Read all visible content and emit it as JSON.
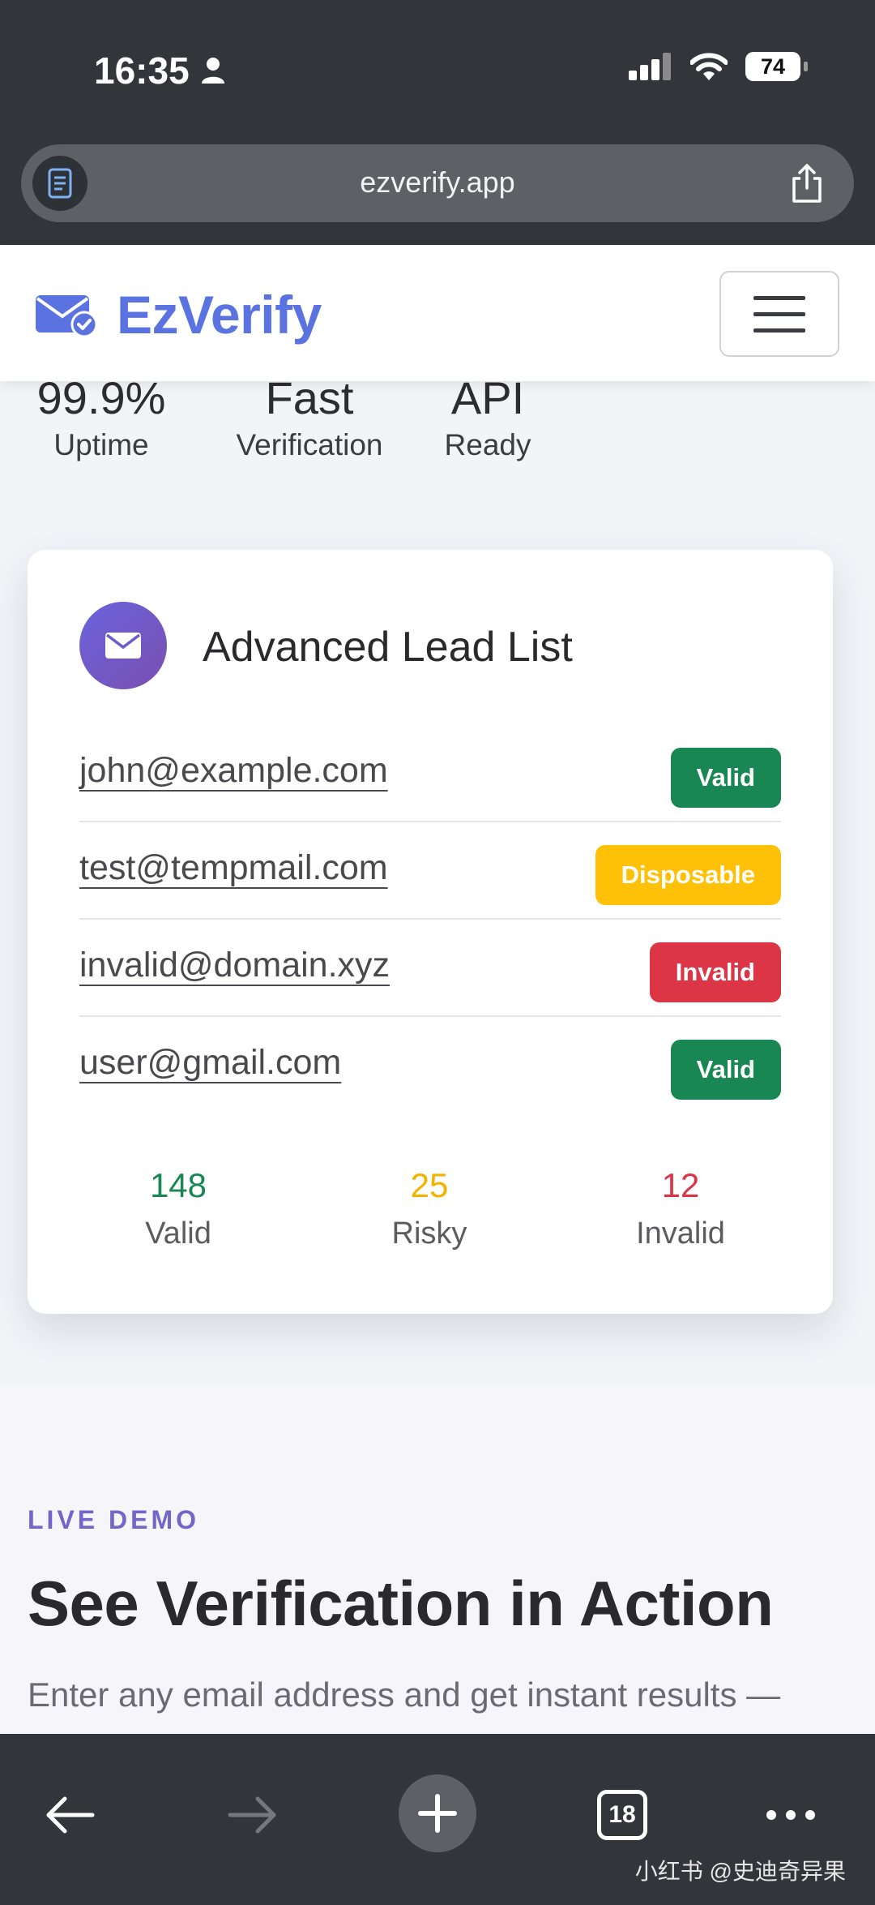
{
  "status_bar": {
    "time": "16:35",
    "battery": "74"
  },
  "browser": {
    "url": "ezverify.app",
    "tab_count": "18"
  },
  "site": {
    "brand_name": "EzVerify"
  },
  "stats": [
    {
      "value": "99.9%",
      "label": "Uptime"
    },
    {
      "value": "Fast",
      "label": "Verification"
    },
    {
      "value": "API",
      "label": "Ready"
    }
  ],
  "card": {
    "title": "Advanced Lead List",
    "emails": [
      {
        "address": "john@example.com",
        "status": "Valid"
      },
      {
        "address": "test@tempmail.com",
        "status": "Disposable"
      },
      {
        "address": "invalid@domain.xyz",
        "status": "Invalid"
      },
      {
        "address": "user@gmail.com",
        "status": "Valid"
      }
    ],
    "summary": [
      {
        "count": "148",
        "label": "Valid"
      },
      {
        "count": "25",
        "label": "Risky"
      },
      {
        "count": "12",
        "label": "Invalid"
      }
    ]
  },
  "demo": {
    "eyebrow": "LIVE DEMO",
    "heading": "See Verification in Action",
    "subtext": "Enter any email address and get instant results —"
  },
  "watermark": "小红书 @史迪奇异果",
  "colors": {
    "brand": "#5b73e0",
    "valid": "#198754",
    "disposable": "#ffc107",
    "invalid": "#dc3545",
    "accent": "#7366c9"
  }
}
